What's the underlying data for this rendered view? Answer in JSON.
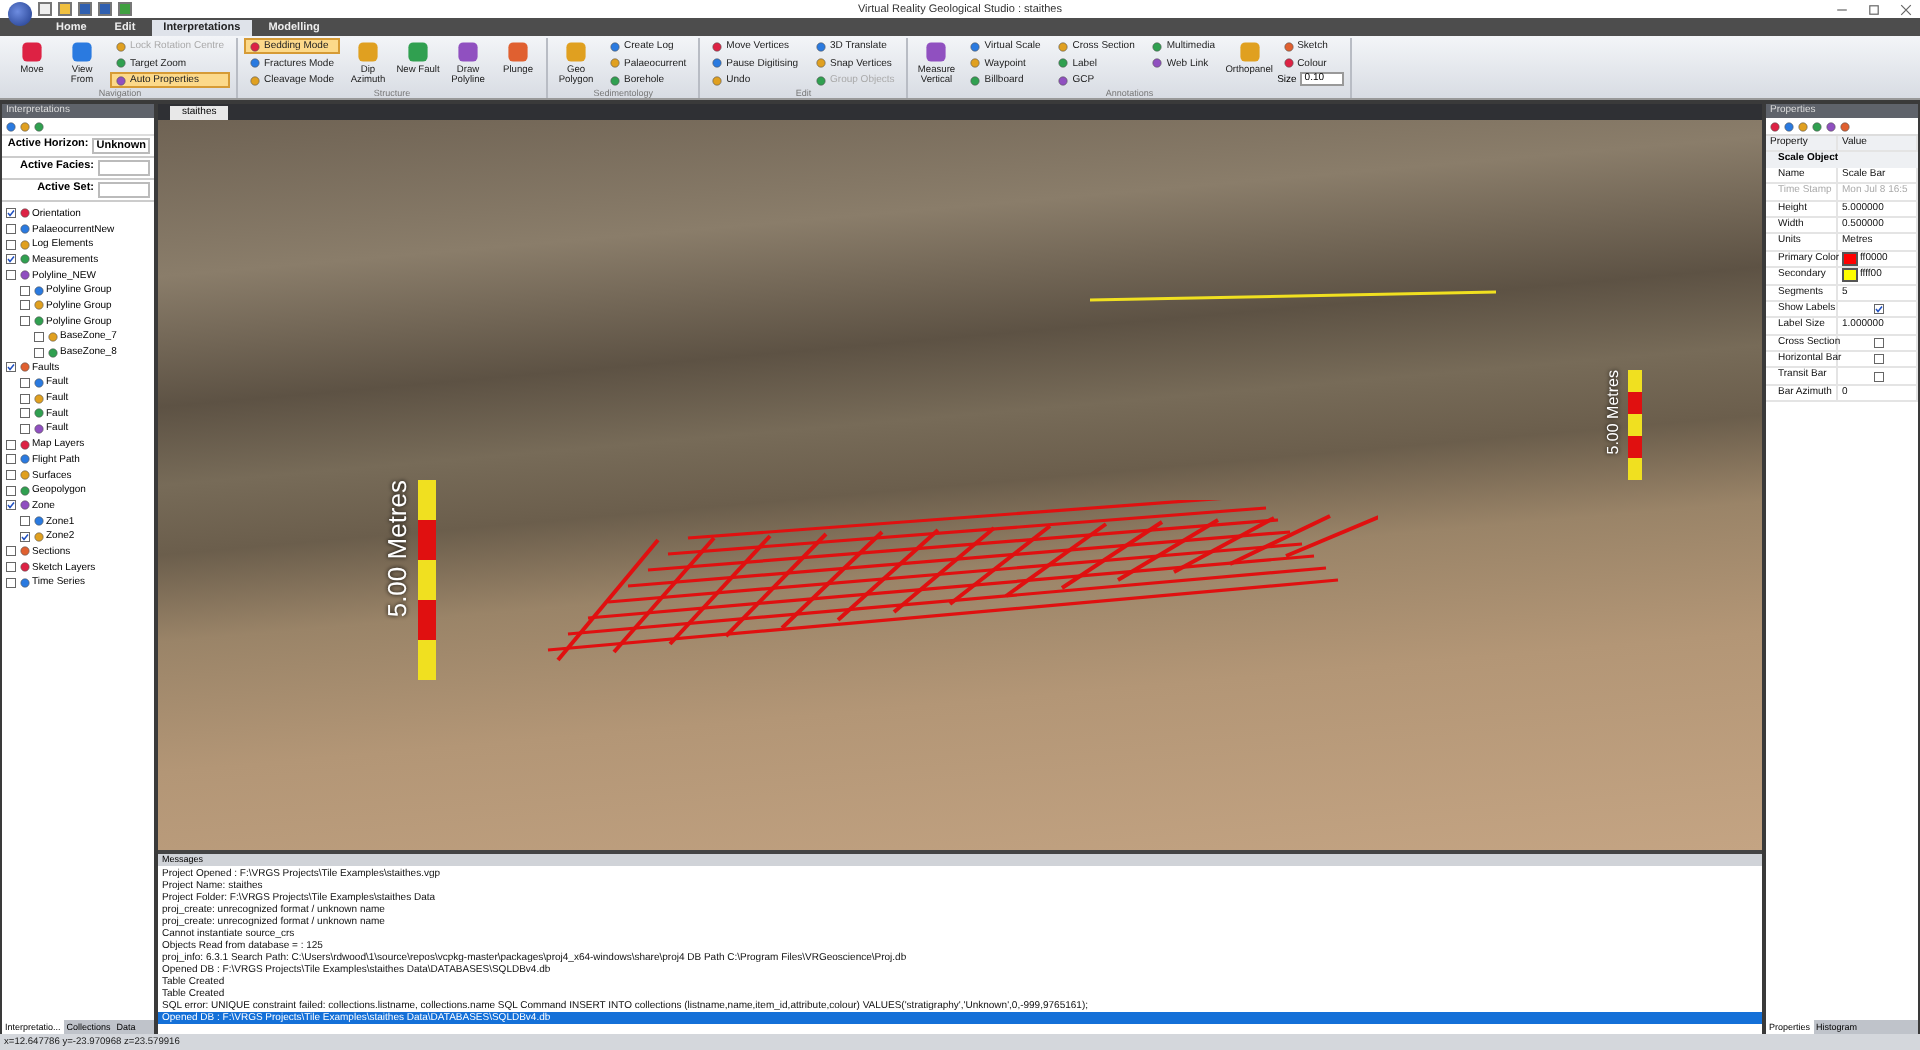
{
  "window": {
    "title": "Virtual Reality Geological Studio : staithes"
  },
  "ribbon_tabs": [
    {
      "label": "Home",
      "selected": false
    },
    {
      "label": "Edit",
      "selected": false
    },
    {
      "label": "Interpretations",
      "selected": true
    },
    {
      "label": "Modelling",
      "selected": false
    }
  ],
  "ribbon_groups": [
    {
      "name": "Navigation",
      "items": [
        {
          "kind": "large",
          "label": "Move"
        },
        {
          "kind": "large",
          "label": "View From"
        },
        {
          "kind": "stack",
          "buttons": [
            {
              "label": "Lock Rotation Centre",
              "disabled": true,
              "selected": false
            },
            {
              "label": "Target Zoom",
              "disabled": false,
              "selected": false
            },
            {
              "label": "Auto Properties",
              "disabled": false,
              "selected": true
            }
          ]
        }
      ]
    },
    {
      "name": "Structure",
      "items": [
        {
          "kind": "stack",
          "buttons": [
            {
              "label": "Bedding Mode",
              "disabled": false,
              "selected": true
            },
            {
              "label": "Fractures Mode",
              "disabled": false,
              "selected": false
            },
            {
              "label": "Cleavage Mode",
              "disabled": false,
              "selected": false
            }
          ]
        },
        {
          "kind": "large",
          "label": "Dip Azimuth"
        },
        {
          "kind": "large",
          "label": "New Fault"
        },
        {
          "kind": "large",
          "label": "Draw Polyline"
        },
        {
          "kind": "large",
          "label": "Plunge"
        }
      ]
    },
    {
      "name": "Sedimentology",
      "items": [
        {
          "kind": "large",
          "label": "Geo Polygon"
        },
        {
          "kind": "stack",
          "buttons": [
            {
              "label": "Create Log",
              "disabled": false,
              "selected": false
            },
            {
              "label": "Palaeocurrent",
              "disabled": false,
              "selected": false
            },
            {
              "label": "Borehole",
              "disabled": false,
              "selected": false
            }
          ]
        }
      ]
    },
    {
      "name": "Edit",
      "items": [
        {
          "kind": "stack",
          "buttons": [
            {
              "label": "Move Vertices",
              "disabled": false,
              "selected": false
            },
            {
              "label": "Pause Digitising",
              "disabled": false,
              "selected": false
            },
            {
              "label": "Undo",
              "disabled": false,
              "selected": false
            }
          ]
        },
        {
          "kind": "stack",
          "buttons": [
            {
              "label": "3D Translate",
              "disabled": false,
              "selected": false
            },
            {
              "label": "Snap Vertices",
              "disabled": false,
              "selected": false
            },
            {
              "label": "Group Objects",
              "disabled": true,
              "selected": false
            }
          ]
        }
      ]
    },
    {
      "name": "Annotations",
      "items": [
        {
          "kind": "large",
          "label": "Measure Vertical"
        },
        {
          "kind": "stack",
          "buttons": [
            {
              "label": "Virtual Scale",
              "disabled": false,
              "selected": false
            },
            {
              "label": "Waypoint",
              "disabled": false,
              "selected": false
            },
            {
              "label": "Billboard",
              "disabled": false,
              "selected": false
            }
          ]
        },
        {
          "kind": "stack",
          "buttons": [
            {
              "label": "Cross Section",
              "disabled": false,
              "selected": false
            },
            {
              "label": "Label",
              "disabled": false,
              "selected": false
            },
            {
              "label": "GCP",
              "disabled": false,
              "selected": false
            }
          ]
        },
        {
          "kind": "stack",
          "buttons": [
            {
              "label": "Multimedia",
              "disabled": false,
              "selected": false
            },
            {
              "label": "Web Link",
              "disabled": false,
              "selected": false
            }
          ]
        },
        {
          "kind": "large",
          "label": "Orthopanel"
        },
        {
          "kind": "stack",
          "buttons": [
            {
              "label": "Sketch",
              "disabled": false,
              "selected": false
            },
            {
              "label": "Colour",
              "disabled": false,
              "selected": false
            }
          ],
          "field": {
            "label": "Size",
            "value": "0.10"
          }
        }
      ]
    }
  ],
  "left_panel": {
    "title": "Interpretations",
    "selectors": [
      {
        "label": "Active Horizon:",
        "value": "Unknown"
      },
      {
        "label": "Active Facies:"
      },
      {
        "label": "Active Set:"
      }
    ],
    "tree": [
      {
        "label": "Orientation",
        "checked": true
      },
      {
        "label": "PalaeocurrentNew",
        "checked": false
      },
      {
        "label": "Log Elements",
        "checked": false
      },
      {
        "label": "Measurements",
        "checked": true
      },
      {
        "label": "Polyline_NEW",
        "checked": false,
        "children": [
          {
            "label": "Polyline Group",
            "checked": false
          },
          {
            "label": "Polyline Group",
            "checked": false
          },
          {
            "label": "Polyline Group",
            "checked": false,
            "children": [
              {
                "label": "BaseZone_7",
                "checked": false
              },
              {
                "label": "BaseZone_8",
                "checked": false
              }
            ]
          }
        ]
      },
      {
        "label": "Faults",
        "checked": true,
        "children": [
          {
            "label": "Fault",
            "checked": false
          },
          {
            "label": "Fault",
            "checked": false
          },
          {
            "label": "Fault",
            "checked": false
          },
          {
            "label": "Fault",
            "checked": false
          }
        ]
      },
      {
        "label": "Map Layers",
        "checked": false
      },
      {
        "label": "Flight Path",
        "checked": false
      },
      {
        "label": "Surfaces",
        "checked": false
      },
      {
        "label": "Geopolygon",
        "checked": false
      },
      {
        "label": "Zone",
        "checked": true,
        "children": [
          {
            "label": "Zone1",
            "checked": false
          },
          {
            "label": "Zone2",
            "checked": true
          }
        ]
      },
      {
        "label": "Sections",
        "checked": false
      },
      {
        "label": "Sketch Layers",
        "checked": false
      },
      {
        "label": "Time Series",
        "checked": false
      }
    ],
    "tabs": [
      {
        "label": "Interpretatio...",
        "selected": true
      },
      {
        "label": "Collections",
        "selected": false
      },
      {
        "label": "Data",
        "selected": false
      }
    ]
  },
  "document_tab": {
    "label": "staithes"
  },
  "viewport": {
    "scale_bars": [
      {
        "label": "5.00 Metres"
      },
      {
        "label": "5.00 Metres"
      }
    ]
  },
  "messages": {
    "title": "Messages",
    "lines": [
      {
        "text": "Project Opened : F:\\VRGS Projects\\Tile Examples\\staithes.vgp",
        "selected": false
      },
      {
        "text": "Project Name: staithes",
        "selected": false
      },
      {
        "text": "Project Folder: F:\\VRGS Projects\\Tile Examples\\staithes Data",
        "selected": false
      },
      {
        "text": "proj_create: unrecognized format / unknown name",
        "selected": false
      },
      {
        "text": "proj_create: unrecognized format / unknown name",
        "selected": false
      },
      {
        "text": "Cannot instantiate source_crs",
        "selected": false
      },
      {
        "text": "Objects Read from database = : 125",
        "selected": false
      },
      {
        "text": "proj_info: 6.3.1 Search Path: C:\\Users\\rdwood\\1\\source\\repos\\vcpkg-master\\packages\\proj4_x64-windows\\share\\proj4 DB Path C:\\Program Files\\VRGeoscience\\Proj.db",
        "selected": false
      },
      {
        "text": "Opened DB : F:\\VRGS Projects\\Tile Examples\\staithes Data\\DATABASES\\SQLDBv4.db",
        "selected": false
      },
      {
        "text": "Table Created",
        "selected": false
      },
      {
        "text": "Table Created",
        "selected": false
      },
      {
        "text": "SQL error: UNIQUE constraint failed: collections.listname, collections.name SQL Command INSERT INTO collections (listname,name,item_id,attribute,colour) VALUES('stratigraphy','Unknown',0,-999,9765161);",
        "selected": false
      },
      {
        "text": "Opened DB : F:\\VRGS Projects\\Tile Examples\\staithes Data\\DATABASES\\SQLDBv4.db",
        "selected": true
      }
    ]
  },
  "properties": {
    "title": "Properties",
    "columns": [
      "Property",
      "Value"
    ],
    "category": "Scale Object",
    "rows": [
      {
        "kind": "text",
        "name": "Name",
        "value": "Scale Bar",
        "disabled": false
      },
      {
        "kind": "text",
        "name": "Time Stamp",
        "value": "Mon Jul 8 16:5",
        "disabled": true
      },
      {
        "kind": "text",
        "name": "Height",
        "value": "5.000000",
        "disabled": false
      },
      {
        "kind": "text",
        "name": "Width",
        "value": "0.500000",
        "disabled": false
      },
      {
        "kind": "text",
        "name": "Units",
        "value": "Metres",
        "disabled": false
      },
      {
        "kind": "color",
        "name": "Primary Color",
        "value": "ff0000",
        "color": "#ff0000",
        "disabled": false
      },
      {
        "kind": "color",
        "name": "Secondary",
        "value": "ffff00",
        "color": "#ffff00",
        "disabled": false
      },
      {
        "kind": "text",
        "name": "Segments",
        "value": "5",
        "disabled": false
      },
      {
        "kind": "check",
        "name": "Show Labels",
        "checked": true,
        "disabled": false
      },
      {
        "kind": "text",
        "name": "Label Size",
        "value": "1.000000",
        "disabled": false
      },
      {
        "kind": "check",
        "name": "Cross Section",
        "checked": false,
        "disabled": false
      },
      {
        "kind": "check",
        "name": "Horizontal Bar",
        "checked": false,
        "disabled": false
      },
      {
        "kind": "check",
        "name": "Transit Bar",
        "checked": false,
        "disabled": false
      },
      {
        "kind": "text",
        "name": "Bar Azimuth",
        "value": "0",
        "disabled": false
      }
    ],
    "tabs": [
      {
        "label": "Properties",
        "selected": true
      },
      {
        "label": "Histogram",
        "selected": false
      }
    ]
  },
  "status_bar": {
    "text": "x=12.647786 y=-23.970968 z=23.579916"
  }
}
